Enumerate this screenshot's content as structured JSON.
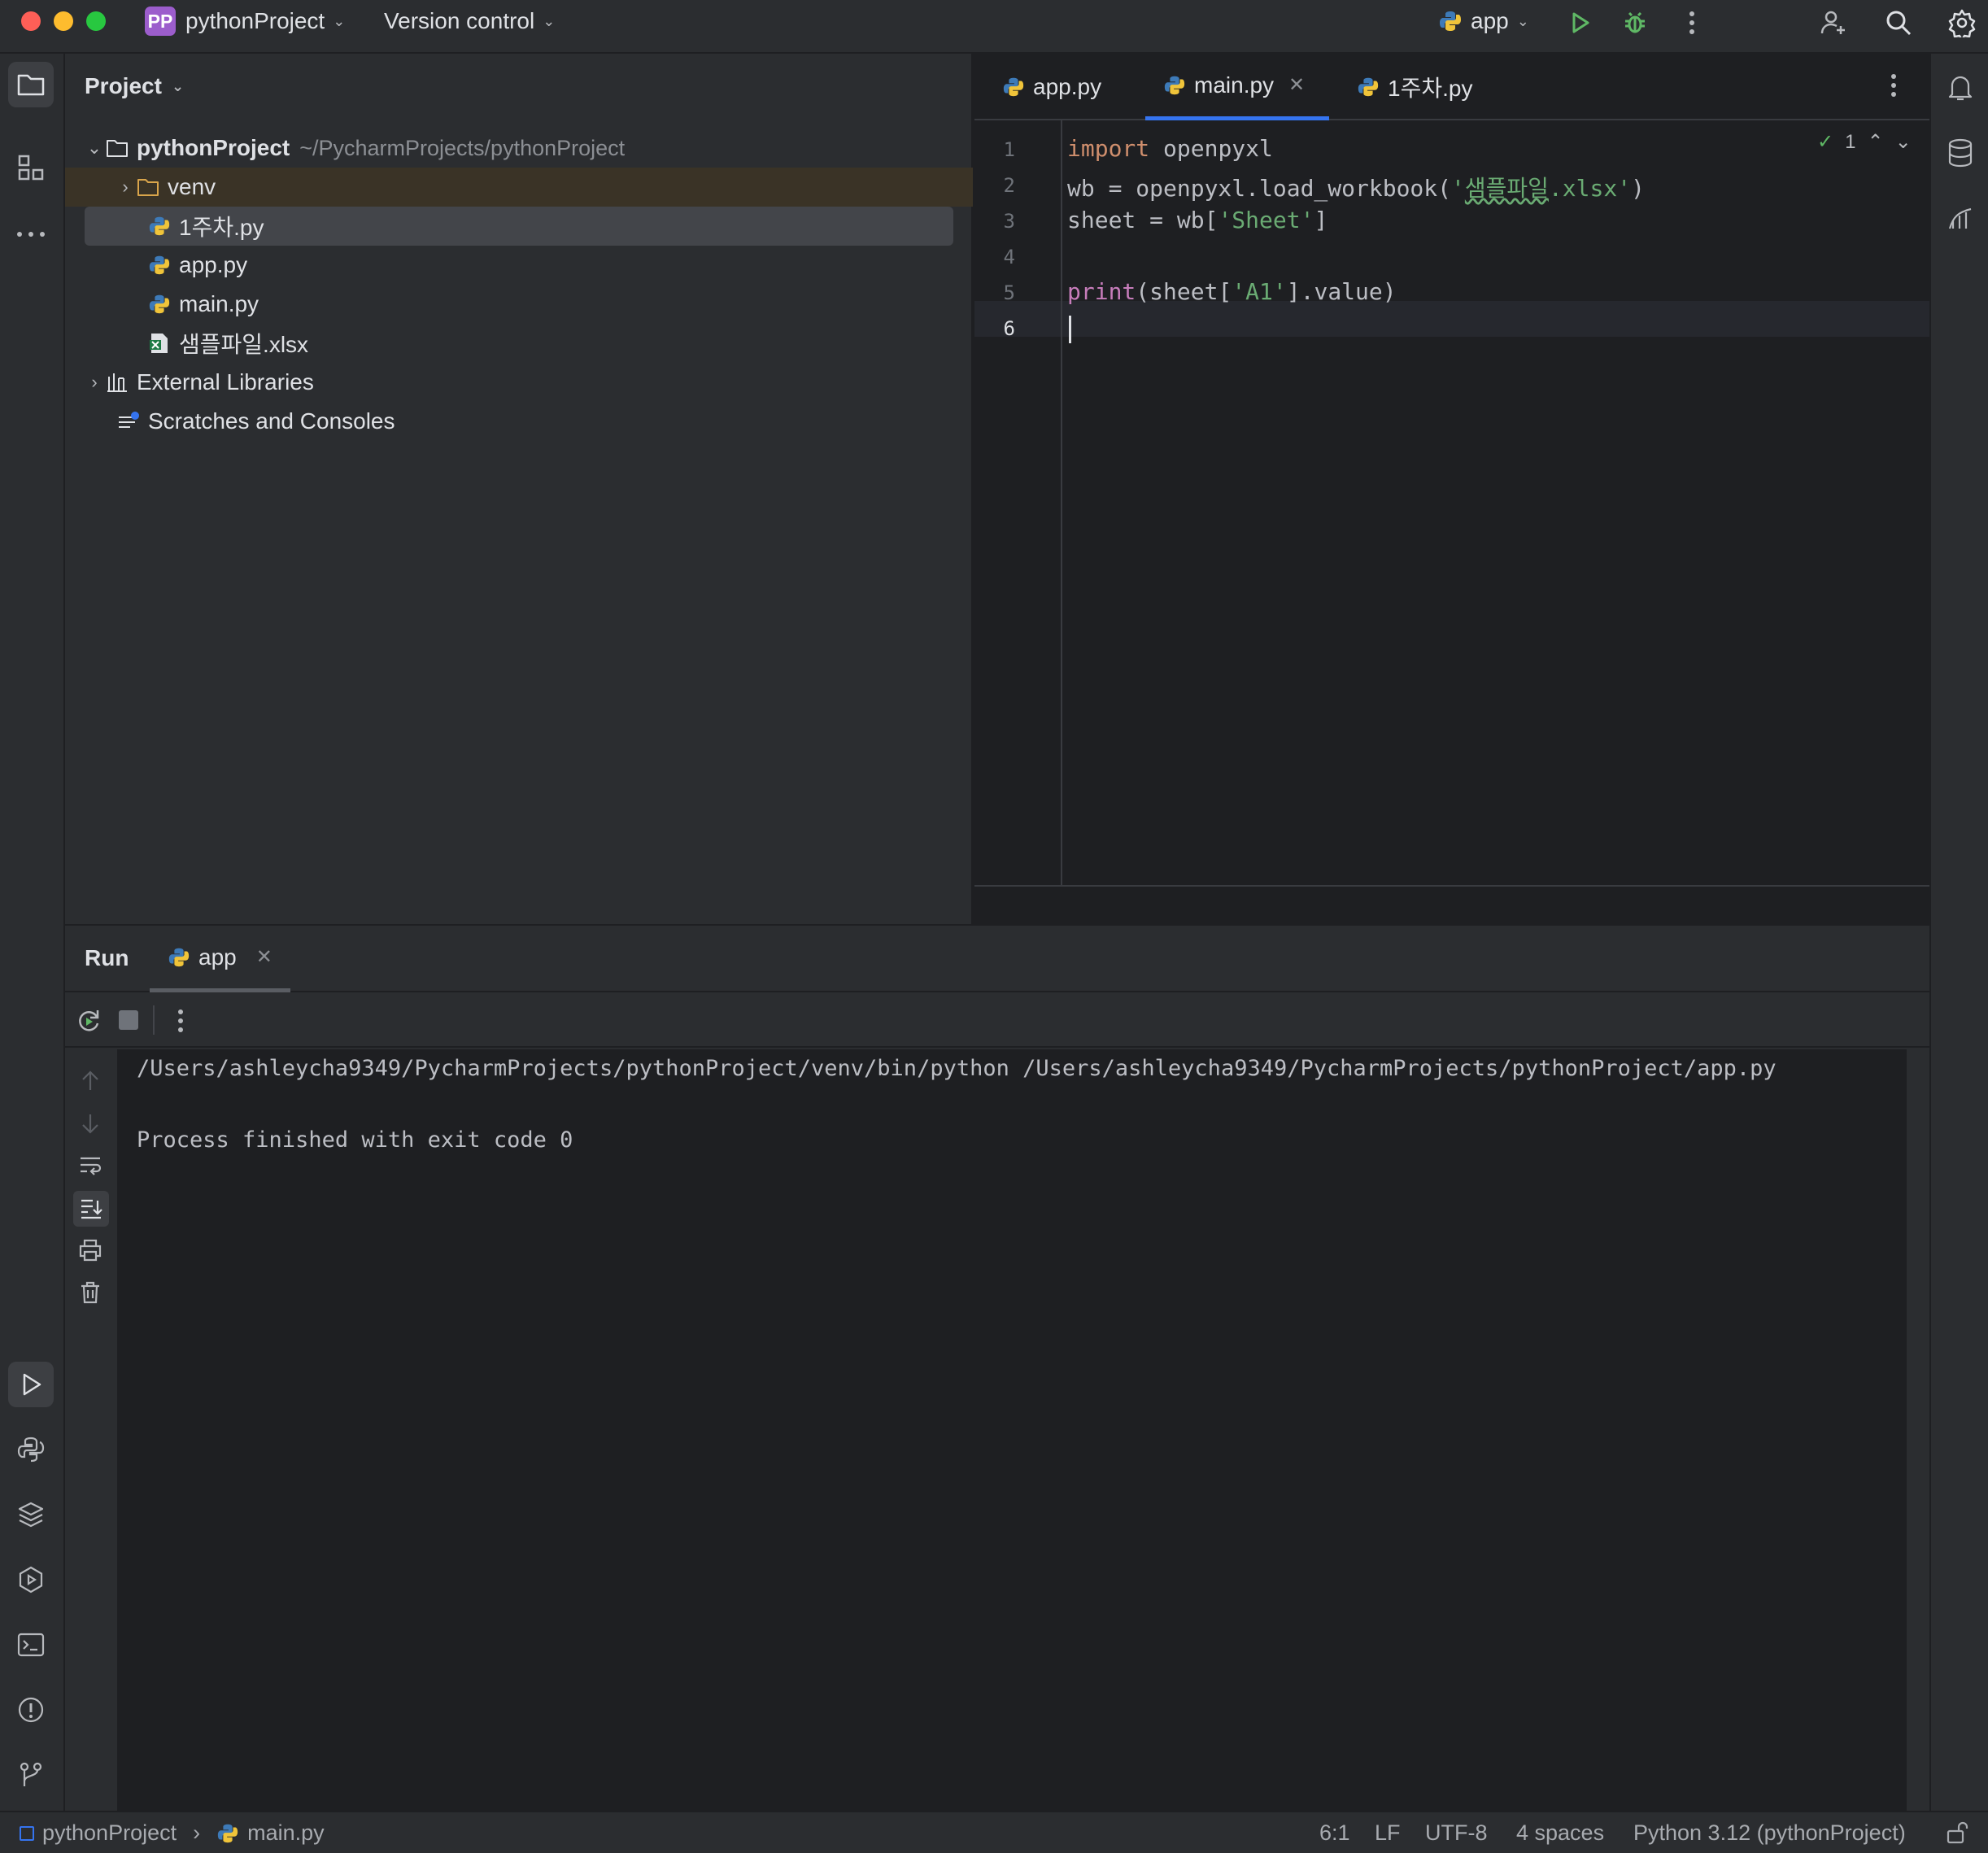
{
  "titlebar": {
    "project_badge": "PP",
    "project_name": "pythonProject",
    "vcs_label": "Version control",
    "run_config": "app"
  },
  "project_panel": {
    "title": "Project",
    "tree": [
      {
        "label": "pythonProject",
        "hint": "~/PycharmProjects/pythonProject",
        "type": "folder",
        "depth": 0,
        "expanded": true
      },
      {
        "label": "venv",
        "type": "folder",
        "depth": 1,
        "expanded": false
      },
      {
        "label": "1주차.py",
        "type": "python",
        "depth": 1,
        "selected": true
      },
      {
        "label": "app.py",
        "type": "python",
        "depth": 1
      },
      {
        "label": "main.py",
        "type": "python",
        "depth": 1
      },
      {
        "label": "샘플파일.xlsx",
        "type": "excel",
        "depth": 1
      },
      {
        "label": "External Libraries",
        "type": "library",
        "depth": 0,
        "expanded": false
      },
      {
        "label": "Scratches and Consoles",
        "type": "scratch",
        "depth": 0
      }
    ]
  },
  "editor": {
    "tabs": [
      {
        "label": "app.py",
        "active": false
      },
      {
        "label": "main.py",
        "active": true
      },
      {
        "label": "1주차.py",
        "active": false
      }
    ],
    "inspection_count": "1",
    "line_numbers": [
      "1",
      "2",
      "3",
      "4",
      "5",
      "6"
    ]
  },
  "run_panel": {
    "title": "Run",
    "tab_label": "app",
    "output": [
      "/Users/ashleycha9349/PycharmProjects/pythonProject/venv/bin/python /Users/ashleycha9349/PycharmProjects/pythonProject/app.py",
      "",
      "Process finished with exit code 0"
    ]
  },
  "statusbar": {
    "breadcrumb_project": "pythonProject",
    "breadcrumb_file": "main.py",
    "position": "6:1",
    "line_sep": "LF",
    "encoding": "UTF-8",
    "indent": "4 spaces",
    "interpreter": "Python 3.12 (pythonProject)"
  },
  "colors": {
    "accent": "#3574f0",
    "keyword": "#cf8e6d",
    "string": "#6aab73",
    "builtin": "#c77dbb",
    "run_green": "#5fb865"
  }
}
